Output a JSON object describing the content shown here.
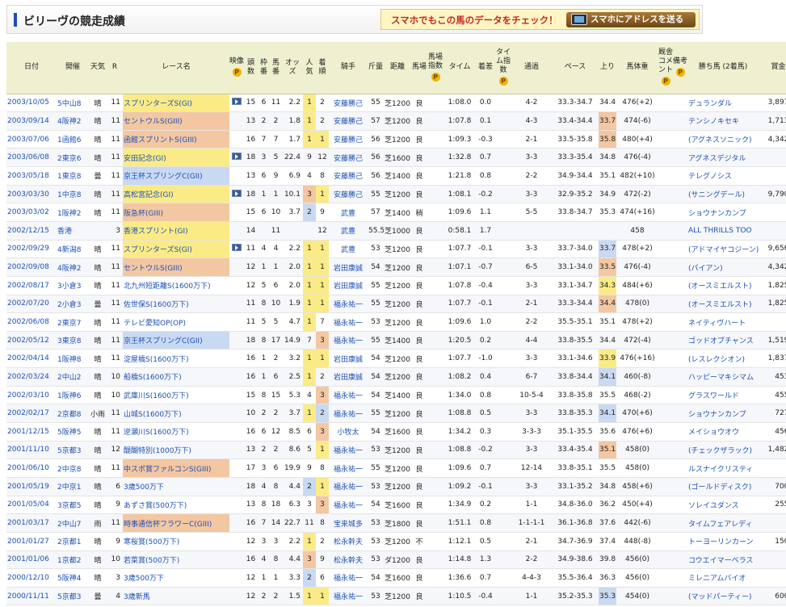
{
  "title": "ビリーヴの競走成績",
  "promo": {
    "text": "スマホでもこの馬のデータをチェック！",
    "button": "スマホにアドレスを送る"
  },
  "headers": {
    "date": "日付",
    "venue": "開催",
    "weather": "天気",
    "r": "R",
    "race": "レース名",
    "video": "映像",
    "heads": "頭数",
    "frame": "枠番",
    "horse_no": "馬番",
    "odds": "オッズ",
    "pop": "人気",
    "rank": "着順",
    "jockey": "騎手",
    "weight": "斤量",
    "dist": "距離",
    "track": "馬場",
    "track_idx": "馬場指数",
    "time": "タイム",
    "margin": "着差",
    "time_idx": "タイム指数",
    "passing": "通過",
    "pace": "ペース",
    "last": "上り",
    "body": "馬体重",
    "comment": "厩舎コメント",
    "memo": "備考",
    "winner": "勝ち馬 (2着馬)",
    "prize": "賞金",
    "p_mark": "P"
  },
  "rows": [
    {
      "date": "2003/10/05",
      "venue": "5中山8",
      "weather": "晴",
      "r": "11",
      "race": "スプリンターズS(GI)",
      "grade": "gold",
      "video": true,
      "heads": "15",
      "frame": "6",
      "no": "11",
      "odds": "2.2",
      "pop": "1",
      "rank": "2",
      "jockey": "安藤勝己",
      "weight": "55",
      "dist": "芝1200",
      "track": "良",
      "time": "1:08.0",
      "margin": "0.0",
      "passing": "4-2",
      "pace": "33.3-34.7",
      "last": "34.4",
      "last_hl": "",
      "body": "476(+2)",
      "winner": "デュランダル",
      "prize": "3,897.2",
      "pop_hl": "hy",
      "rank_hl": ""
    },
    {
      "date": "2003/09/14",
      "venue": "4阪神2",
      "weather": "晴",
      "r": "11",
      "race": "セントウルS(GIII)",
      "grade": "orange",
      "video": false,
      "heads": "13",
      "frame": "2",
      "no": "2",
      "odds": "1.8",
      "pop": "1",
      "rank": "2",
      "jockey": "安藤勝己",
      "weight": "57",
      "dist": "芝1200",
      "track": "良",
      "time": "1:07.8",
      "margin": "0.1",
      "passing": "4-3",
      "pace": "33.4-34.4",
      "last": "33.7",
      "last_hl": "ho",
      "body": "474(-6)",
      "winner": "テンシノキセキ",
      "prize": "1,713.6",
      "pop_hl": "hy",
      "rank_hl": ""
    },
    {
      "date": "2003/07/06",
      "venue": "1函館6",
      "weather": "晴",
      "r": "11",
      "race": "函館スプリントS(GIII)",
      "grade": "orange",
      "video": false,
      "heads": "16",
      "frame": "7",
      "no": "7",
      "odds": "1.7",
      "pop": "1",
      "rank": "1",
      "jockey": "安藤勝己",
      "weight": "56",
      "dist": "芝1200",
      "track": "良",
      "time": "1:09.3",
      "margin": "-0.3",
      "passing": "2-1",
      "pace": "33.5-35.8",
      "last": "35.8",
      "last_hl": "ho",
      "body": "480(+4)",
      "winner": "(アグネスソニック)",
      "prize": "4,342.7",
      "pop_hl": "hy",
      "rank_hl": "hy"
    },
    {
      "date": "2003/06/08",
      "venue": "2東京6",
      "weather": "晴",
      "r": "11",
      "race": "安田記念(GI)",
      "grade": "gold",
      "video": true,
      "heads": "18",
      "frame": "3",
      "no": "5",
      "odds": "22.4",
      "pop": "9",
      "rank": "12",
      "jockey": "安藤勝己",
      "weight": "56",
      "dist": "芝1600",
      "track": "良",
      "time": "1:32.8",
      "margin": "0.7",
      "passing": "3-3",
      "pace": "33.3-35.4",
      "last": "34.8",
      "last_hl": "",
      "body": "476(-4)",
      "winner": "アグネスデジタル",
      "prize": "",
      "pop_hl": "",
      "rank_hl": ""
    },
    {
      "date": "2003/05/18",
      "venue": "1東京8",
      "weather": "曇",
      "r": "11",
      "race": "京王杯スプリングC(GII)",
      "grade": "blue",
      "video": false,
      "heads": "13",
      "frame": "6",
      "no": "9",
      "odds": "6.9",
      "pop": "4",
      "rank": "8",
      "jockey": "安藤勝己",
      "weight": "56",
      "dist": "芝1400",
      "track": "良",
      "time": "1:21.8",
      "margin": "0.8",
      "passing": "2-2",
      "pace": "34.9-34.4",
      "last": "35.1",
      "last_hl": "",
      "body": "482(+10)",
      "winner": "テレグノシス",
      "prize": "",
      "pop_hl": "",
      "rank_hl": ""
    },
    {
      "date": "2003/03/30",
      "venue": "1中京8",
      "weather": "晴",
      "r": "11",
      "race": "高松宮記念(GI)",
      "grade": "gold",
      "video": true,
      "heads": "18",
      "frame": "1",
      "no": "1",
      "odds": "10.1",
      "pop": "3",
      "rank": "1",
      "jockey": "安藤勝己",
      "weight": "55",
      "dist": "芝1200",
      "track": "良",
      "time": "1:08.1",
      "margin": "-0.2",
      "passing": "3-3",
      "pace": "32.9-35.2",
      "last": "34.9",
      "last_hl": "",
      "body": "472(-2)",
      "winner": "(サニングデール)",
      "prize": "9,790.6",
      "pop_hl": "ho",
      "rank_hl": "hy"
    },
    {
      "date": "2003/03/02",
      "venue": "1阪神2",
      "weather": "晴",
      "r": "11",
      "race": "阪急杯(GIII)",
      "grade": "orange",
      "video": false,
      "heads": "15",
      "frame": "6",
      "no": "10",
      "odds": "3.7",
      "pop": "2",
      "rank": "9",
      "jockey": "武豊",
      "weight": "57",
      "dist": "芝1400",
      "track": "稍",
      "time": "1:09.6",
      "margin": "1.1",
      "passing": "5-5",
      "pace": "33.8-34.7",
      "last": "35.3",
      "last_hl": "",
      "body": "474(+16)",
      "winner": "ショウナンカンプ",
      "prize": "",
      "pop_hl": "hb",
      "rank_hl": ""
    },
    {
      "date": "2002/12/15",
      "venue": "香港",
      "weather": "",
      "r": "3",
      "race": "香港スプリント(GI)",
      "grade": "gold",
      "video": false,
      "heads": "14",
      "frame": "",
      "no": "11",
      "odds": "",
      "pop": "",
      "rank": "12",
      "jockey": "武豊",
      "weight": "55.5",
      "dist": "芝1000",
      "track": "良",
      "time": "0:58.1",
      "margin": "1.7",
      "passing": "",
      "pace": "",
      "last": "",
      "last_hl": "",
      "body": "458",
      "winner": "ALL THRILLS TOO",
      "prize": "",
      "pop_hl": "",
      "rank_hl": ""
    },
    {
      "date": "2002/09/29",
      "venue": "4新潟8",
      "weather": "晴",
      "r": "11",
      "race": "スプリンターズS(GI)",
      "grade": "gold",
      "video": true,
      "heads": "11",
      "frame": "4",
      "no": "4",
      "odds": "2.2",
      "pop": "1",
      "rank": "1",
      "jockey": "武豊",
      "weight": "53",
      "dist": "芝1200",
      "track": "良",
      "time": "1:07.7",
      "margin": "-0.1",
      "passing": "3-3",
      "pace": "33.7-34.0",
      "last": "33.7",
      "last_hl": "hb",
      "body": "478(+2)",
      "winner": "(アドマイヤコジーン)",
      "prize": "9,656.2",
      "pop_hl": "hy",
      "rank_hl": "hy"
    },
    {
      "date": "2002/09/08",
      "venue": "4阪神2",
      "weather": "晴",
      "r": "11",
      "race": "セントウルS(GIII)",
      "grade": "orange",
      "video": false,
      "heads": "12",
      "frame": "1",
      "no": "1",
      "odds": "2.0",
      "pop": "1",
      "rank": "1",
      "jockey": "岩田康誠",
      "weight": "54",
      "dist": "芝1200",
      "track": "良",
      "time": "1:07.1",
      "margin": "-0.7",
      "passing": "6-5",
      "pace": "33.1-34.0",
      "last": "33.5",
      "last_hl": "ho",
      "body": "476(-4)",
      "winner": "(パイアン)",
      "prize": "4,342.7",
      "pop_hl": "hy",
      "rank_hl": "hy"
    },
    {
      "date": "2002/08/17",
      "venue": "3小倉3",
      "weather": "晴",
      "r": "11",
      "race": "北九州短距離S(1600万下)",
      "grade": "",
      "video": false,
      "heads": "12",
      "frame": "5",
      "no": "6",
      "odds": "2.0",
      "pop": "1",
      "rank": "1",
      "jockey": "岩田康誠",
      "weight": "55",
      "dist": "芝1200",
      "track": "良",
      "time": "1:07.8",
      "margin": "-0.4",
      "passing": "3-3",
      "pace": "33.1-34.7",
      "last": "34.3",
      "last_hl": "hy",
      "body": "484(+6)",
      "winner": "(オースミエルスト)",
      "prize": "1,825.2",
      "pop_hl": "hy",
      "rank_hl": "hy"
    },
    {
      "date": "2002/07/20",
      "venue": "2小倉3",
      "weather": "曇",
      "r": "11",
      "race": "佐世保S(1600万下)",
      "grade": "",
      "video": false,
      "heads": "11",
      "frame": "8",
      "no": "10",
      "odds": "1.9",
      "pop": "1",
      "rank": "1",
      "jockey": "福永祐一",
      "weight": "55",
      "dist": "芝1200",
      "track": "良",
      "time": "1:07.7",
      "margin": "-0.1",
      "passing": "2-1",
      "pace": "33.3-34.4",
      "last": "34.4",
      "last_hl": "ho",
      "body": "478(0)",
      "winner": "(オースミエルスト)",
      "prize": "1,825.9",
      "pop_hl": "hy",
      "rank_hl": "hy"
    },
    {
      "date": "2002/06/08",
      "venue": "2東京7",
      "weather": "晴",
      "r": "11",
      "race": "テレビ愛知OP(OP)",
      "grade": "",
      "video": false,
      "heads": "11",
      "frame": "5",
      "no": "5",
      "odds": "4.7",
      "pop": "1",
      "rank": "7",
      "jockey": "福永祐一",
      "weight": "53",
      "dist": "芝1200",
      "track": "良",
      "time": "1:09.6",
      "margin": "1.0",
      "passing": "2-2",
      "pace": "35.5-35.1",
      "last": "35.1",
      "last_hl": "",
      "body": "478(+2)",
      "winner": "ネイティヴハート",
      "prize": "",
      "pop_hl": "hy",
      "rank_hl": ""
    },
    {
      "date": "2002/05/12",
      "venue": "3東京8",
      "weather": "晴",
      "r": "11",
      "race": "京王杯スプリングC(GII)",
      "grade": "blue",
      "video": false,
      "heads": "18",
      "frame": "8",
      "no": "17",
      "odds": "14.9",
      "pop": "7",
      "rank": "3",
      "jockey": "福永祐一",
      "weight": "55",
      "dist": "芝1400",
      "track": "良",
      "time": "1:20.5",
      "margin": "0.2",
      "passing": "4-4",
      "pace": "33.8-35.5",
      "last": "34.4",
      "last_hl": "",
      "body": "472(-4)",
      "winner": "ゴッドオブチャンス",
      "prize": "1,519.4",
      "pop_hl": "",
      "rank_hl": "ho"
    },
    {
      "date": "2002/04/14",
      "venue": "1阪神8",
      "weather": "晴",
      "r": "11",
      "race": "淀屋橋S(1600万下)",
      "grade": "",
      "video": false,
      "heads": "16",
      "frame": "1",
      "no": "2",
      "odds": "3.2",
      "pop": "1",
      "rank": "1",
      "jockey": "岩田康誠",
      "weight": "54",
      "dist": "芝1200",
      "track": "良",
      "time": "1:07.7",
      "margin": "-1.0",
      "passing": "3-3",
      "pace": "33.1-34.6",
      "last": "33.9",
      "last_hl": "hy",
      "body": "476(+16)",
      "winner": "(レスレクシオン)",
      "prize": "1,837.1",
      "pop_hl": "hy",
      "rank_hl": "hy"
    },
    {
      "date": "2002/03/24",
      "venue": "2中山2",
      "weather": "晴",
      "r": "10",
      "race": "船橋S(1600万下)",
      "grade": "",
      "video": false,
      "heads": "16",
      "frame": "1",
      "no": "6",
      "odds": "2.5",
      "pop": "1",
      "rank": "2",
      "jockey": "岩田康誠",
      "weight": "54",
      "dist": "芝1200",
      "track": "良",
      "time": "1:08.2",
      "margin": "0.4",
      "passing": "6-7",
      "pace": "33.8-34.4",
      "last": "34.1",
      "last_hl": "hb",
      "body": "460(-8)",
      "winner": "ハッピーマキシマム",
      "prize": "453.6",
      "pop_hl": "hy",
      "rank_hl": ""
    },
    {
      "date": "2002/03/10",
      "venue": "1阪神6",
      "weather": "晴",
      "r": "10",
      "race": "武庫川S(1600万下)",
      "grade": "",
      "video": false,
      "heads": "15",
      "frame": "8",
      "no": "15",
      "odds": "5.3",
      "pop": "4",
      "rank": "3",
      "jockey": "福永祐一",
      "weight": "54",
      "dist": "芝1400",
      "track": "良",
      "time": "1:34.0",
      "margin": "0.8",
      "passing": "10-5-4",
      "pace": "33.8-35.8",
      "last": "35.5",
      "last_hl": "",
      "body": "468(-2)",
      "winner": "グラスワールド",
      "prize": "455.1",
      "pop_hl": "",
      "rank_hl": "ho"
    },
    {
      "date": "2002/02/17",
      "venue": "2京都8",
      "weather": "小雨",
      "r": "11",
      "race": "山城S(1600万下)",
      "grade": "",
      "video": false,
      "heads": "10",
      "frame": "2",
      "no": "2",
      "odds": "3.7",
      "pop": "1",
      "rank": "2",
      "jockey": "福永祐一",
      "weight": "55",
      "dist": "芝1200",
      "track": "良",
      "time": "1:08.8",
      "margin": "0.5",
      "passing": "3-3",
      "pace": "33.8-35.3",
      "last": "34.1",
      "last_hl": "hb",
      "body": "470(+6)",
      "winner": "ショウナンカンプ",
      "prize": "727.6",
      "pop_hl": "hy",
      "rank_hl": "hb"
    },
    {
      "date": "2001/12/15",
      "venue": "5阪神5",
      "weather": "晴",
      "r": "11",
      "race": "逆瀬川S(1600万下)",
      "grade": "",
      "video": false,
      "heads": "16",
      "frame": "6",
      "no": "12",
      "odds": "8.5",
      "pop": "6",
      "rank": "3",
      "jockey": "小牧太",
      "weight": "54",
      "dist": "芝1600",
      "track": "良",
      "time": "1:34.2",
      "margin": "0.3",
      "passing": "3-3-3",
      "pace": "35.1-35.5",
      "last": "35.6",
      "last_hl": "",
      "body": "476(+6)",
      "winner": "メイショウオウ",
      "prize": "456.1",
      "pop_hl": "",
      "rank_hl": "ho"
    },
    {
      "date": "2001/11/10",
      "venue": "5京都3",
      "weather": "晴",
      "r": "12",
      "race": "醍醐特別(1000万下)",
      "grade": "",
      "video": false,
      "heads": "13",
      "frame": "2",
      "no": "2",
      "odds": "8.6",
      "pop": "5",
      "rank": "1",
      "jockey": "福永祐一",
      "weight": "53",
      "dist": "芝1200",
      "track": "良",
      "time": "1:08.8",
      "margin": "-0.2",
      "passing": "3-3",
      "pace": "33.4-35.4",
      "last": "35.1",
      "last_hl": "ho",
      "body": "458(0)",
      "winner": "(チェックザラック)",
      "prize": "1,482.9",
      "pop_hl": "",
      "rank_hl": "hy"
    },
    {
      "date": "2001/06/10",
      "venue": "2中京8",
      "weather": "晴",
      "r": "11",
      "race": "中スポ賞ファルコンS(GIII)",
      "grade": "orange",
      "video": false,
      "heads": "17",
      "frame": "3",
      "no": "6",
      "odds": "19.9",
      "pop": "9",
      "rank": "8",
      "jockey": "福永祐一",
      "weight": "55",
      "dist": "芝1200",
      "track": "良",
      "time": "1:09.6",
      "margin": "0.7",
      "passing": "12-14",
      "pace": "33.8-35.1",
      "last": "35.5",
      "last_hl": "",
      "body": "458(0)",
      "winner": "ルスナイクリスティ",
      "prize": "",
      "pop_hl": "",
      "rank_hl": ""
    },
    {
      "date": "2001/05/19",
      "venue": "2中京1",
      "weather": "晴",
      "r": "6",
      "race": "3歳500万下",
      "grade": "",
      "video": false,
      "heads": "18",
      "frame": "4",
      "no": "8",
      "odds": "4.4",
      "pop": "2",
      "rank": "1",
      "jockey": "福永祐一",
      "weight": "53",
      "dist": "芝1200",
      "track": "良",
      "time": "1:09.2",
      "margin": "-0.1",
      "passing": "3-3",
      "pace": "33.1-35.2",
      "last": "34.8",
      "last_hl": "",
      "body": "458(+6)",
      "winner": "(ゴールドディスク)",
      "prize": "700.0",
      "pop_hl": "hb",
      "rank_hl": "hy"
    },
    {
      "date": "2001/05/04",
      "venue": "3京都5",
      "weather": "晴",
      "r": "9",
      "race": "あずさ賞(500万下)",
      "grade": "",
      "video": false,
      "heads": "13",
      "frame": "8",
      "no": "18",
      "odds": "6.3",
      "pop": "3",
      "rank": "3",
      "jockey": "福永祐一",
      "weight": "54",
      "dist": "芝1600",
      "track": "良",
      "time": "1:34.9",
      "margin": "0.2",
      "passing": "1-1",
      "pace": "34.8-36.0",
      "last": "36.2",
      "last_hl": "",
      "body": "450(+4)",
      "winner": "ソレイユダンス",
      "prize": "255.9",
      "pop_hl": "",
      "rank_hl": "ho"
    },
    {
      "date": "2001/03/17",
      "venue": "2中山7",
      "weather": "雨",
      "r": "11",
      "race": "時事通信杯フラワーC(GIII)",
      "grade": "orange",
      "video": false,
      "heads": "16",
      "frame": "7",
      "no": "14",
      "odds": "22.7",
      "pop": "11",
      "rank": "8",
      "jockey": "宝来城多",
      "weight": "53",
      "dist": "芝1800",
      "track": "良",
      "time": "1:51.1",
      "margin": "0.8",
      "passing": "1-1-1-1",
      "pace": "36.1-36.8",
      "last": "37.6",
      "last_hl": "",
      "body": "442(-6)",
      "winner": "タイムフェアレディ",
      "prize": "",
      "pop_hl": "",
      "rank_hl": ""
    },
    {
      "date": "2001/01/27",
      "venue": "2京都1",
      "weather": "晴",
      "r": "9",
      "race": "寒桜賞(500万下)",
      "grade": "",
      "video": false,
      "heads": "12",
      "frame": "3",
      "no": "3",
      "odds": "2.2",
      "pop": "1",
      "rank": "2",
      "jockey": "松永幹夫",
      "weight": "53",
      "dist": "芝1200",
      "track": "不",
      "time": "1:12.1",
      "margin": "0.5",
      "passing": "2-1",
      "pace": "34.7-36.9",
      "last": "37.4",
      "last_hl": "",
      "body": "448(-8)",
      "winner": "トーヨーリンカーン",
      "prize": "150.0",
      "pop_hl": "hy",
      "rank_hl": ""
    },
    {
      "date": "2001/01/06",
      "venue": "1京都2",
      "weather": "晴",
      "r": "10",
      "race": "若菜賞(500万下)",
      "grade": "",
      "video": false,
      "heads": "16",
      "frame": "4",
      "no": "8",
      "odds": "4.4",
      "pop": "3",
      "rank": "9",
      "jockey": "松永幹夫",
      "weight": "53",
      "dist": "ダ1200",
      "track": "良",
      "time": "1:14.8",
      "margin": "1.3",
      "passing": "2-2",
      "pace": "34.9-38.6",
      "last": "39.8",
      "last_hl": "",
      "body": "456(0)",
      "winner": "コウエイマーベラス",
      "prize": "",
      "pop_hl": "ho",
      "rank_hl": ""
    },
    {
      "date": "2000/12/10",
      "venue": "5阪神4",
      "weather": "晴",
      "r": "3",
      "race": "3歳500万下",
      "grade": "",
      "video": false,
      "heads": "12",
      "frame": "1",
      "no": "1",
      "odds": "3.3",
      "pop": "2",
      "rank": "6",
      "jockey": "福永祐一",
      "weight": "54",
      "dist": "芝1600",
      "track": "良",
      "time": "1:36.6",
      "margin": "0.7",
      "passing": "4-4-3",
      "pace": "35.5-36.4",
      "last": "36.3",
      "last_hl": "",
      "body": "456(0)",
      "winner": "ミレニアムバイオ",
      "prize": "",
      "pop_hl": "hb",
      "rank_hl": ""
    },
    {
      "date": "2000/11/11",
      "venue": "5京都3",
      "weather": "曇",
      "r": "4",
      "race": "3歳新馬",
      "grade": "",
      "video": false,
      "heads": "12",
      "frame": "2",
      "no": "2",
      "odds": "1.5",
      "pop": "1",
      "rank": "1",
      "jockey": "福永祐一",
      "weight": "53",
      "dist": "芝1200",
      "track": "良",
      "time": "1:10.5",
      "margin": "-0.4",
      "passing": "1-1",
      "pace": "35.2-35.3",
      "last": "35.3",
      "last_hl": "hb",
      "body": "454(0)",
      "winner": "(マッドパーティー)",
      "prize": "600.0",
      "pop_hl": "hy",
      "rank_hl": "hy"
    }
  ]
}
